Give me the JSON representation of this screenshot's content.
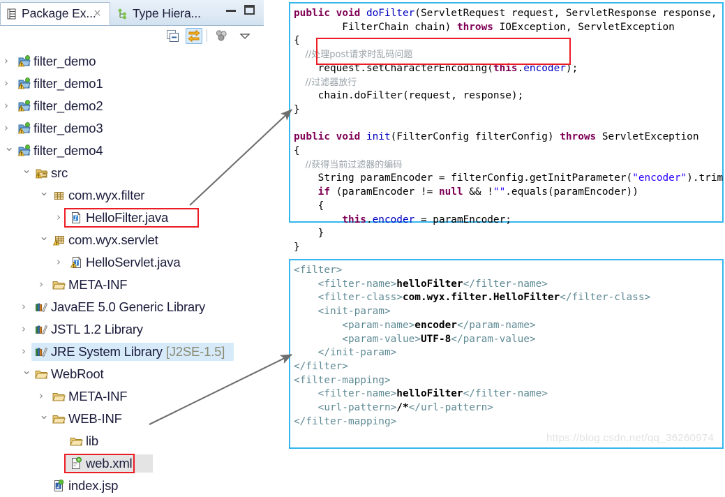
{
  "window": {
    "minimize_label": "Minimize",
    "maximize_label": "Maximize"
  },
  "tabs": [
    {
      "label": "Package Ex...",
      "icon": "package-explorer-icon",
      "active": true,
      "closable": true,
      "close_label": "×"
    },
    {
      "label": "Type Hiera...",
      "icon": "type-hierarchy-icon",
      "active": false,
      "closable": false
    }
  ],
  "toolbar": {
    "collapse_all": "Collapse All",
    "link_with_editor": "Link with Editor",
    "view_menu": "View Menu",
    "chevron": "View Menu Chevron"
  },
  "tree": [
    {
      "label": "filter_demo",
      "indent": 0,
      "twisty": "right",
      "icon": "java-project-icon"
    },
    {
      "label": "filter_demo1",
      "indent": 0,
      "twisty": "right",
      "icon": "java-project-icon"
    },
    {
      "label": "filter_demo2",
      "indent": 0,
      "twisty": "right",
      "icon": "java-project-icon"
    },
    {
      "label": "filter_demo3",
      "indent": 0,
      "twisty": "right",
      "icon": "java-project-icon"
    },
    {
      "label": "filter_demo4",
      "indent": 0,
      "twisty": "down",
      "icon": "java-project-icon"
    },
    {
      "label": "src",
      "indent": 1,
      "twisty": "down",
      "icon": "source-folder-icon"
    },
    {
      "label": "com.wyx.filter",
      "indent": 2,
      "twisty": "down",
      "icon": "package-icon"
    },
    {
      "label": "HelloFilter.java",
      "indent": 3,
      "twisty": "right",
      "icon": "java-file-icon",
      "boxed": true
    },
    {
      "label": "com.wyx.servlet",
      "indent": 2,
      "twisty": "down",
      "icon": "package-warning-icon"
    },
    {
      "label": "HelloServlet.java",
      "indent": 3,
      "twisty": "right",
      "icon": "java-file-warning-icon"
    },
    {
      "label": "META-INF",
      "indent": 2,
      "twisty": "right",
      "icon": "folder-icon"
    },
    {
      "label": "JavaEE 5.0 Generic Library",
      "indent": 1,
      "twisty": "right",
      "icon": "library-icon"
    },
    {
      "label": "JSTL 1.2 Library",
      "indent": 1,
      "twisty": "right",
      "icon": "library-icon"
    },
    {
      "label": "JRE System Library",
      "suffix": " [J2SE-1.5]",
      "indent": 1,
      "twisty": "right",
      "icon": "library-icon",
      "selected": true
    },
    {
      "label": "WebRoot",
      "indent": 1,
      "twisty": "down",
      "icon": "folder-icon"
    },
    {
      "label": "META-INF",
      "indent": 2,
      "twisty": "right",
      "icon": "folder-icon"
    },
    {
      "label": "WEB-INF",
      "indent": 2,
      "twisty": "down",
      "icon": "folder-icon"
    },
    {
      "label": "lib",
      "indent": 3,
      "twisty": "none",
      "icon": "folder-icon"
    },
    {
      "label": "web.xml",
      "indent": 3,
      "twisty": "none",
      "icon": "xml-file-icon",
      "boxed": true,
      "grayed": true
    },
    {
      "label": "index.jsp",
      "indent": 2,
      "twisty": "none",
      "icon": "jsp-file-icon"
    }
  ],
  "java_panel": {
    "name": "HelloFilter.java source",
    "border_color": "#35b6ef",
    "highlight_color": "#ed1c24",
    "lines": [
      [
        [
          "k",
          "public"
        ],
        [
          "p",
          " "
        ],
        [
          "k",
          "void"
        ],
        [
          "p",
          " "
        ],
        [
          "f",
          "doFilter"
        ],
        [
          "p",
          "(ServletRequest request, ServletResponse response,"
        ]
      ],
      [
        [
          "p",
          "        FilterChain chain) "
        ],
        [
          "k",
          "throws"
        ],
        [
          "p",
          " IOException, ServletException"
        ]
      ],
      [
        [
          "p",
          "{"
        ]
      ],
      [
        [
          "c",
          "    //处理post请求时乱码问题"
        ]
      ],
      [
        [
          "p",
          "    request.setCharacterEncoding("
        ],
        [
          "k",
          "this"
        ],
        [
          "p",
          "."
        ],
        [
          "f",
          "encoder"
        ],
        [
          "p",
          ");"
        ]
      ],
      [
        [
          "c",
          "    //过滤器放行"
        ]
      ],
      [
        [
          "p",
          "    chain.doFilter(request, response);"
        ]
      ],
      [
        [
          "p",
          "}"
        ]
      ],
      [
        [
          "p",
          ""
        ]
      ],
      [
        [
          "k",
          "public"
        ],
        [
          "p",
          " "
        ],
        [
          "k",
          "void"
        ],
        [
          "p",
          " "
        ],
        [
          "f",
          "init"
        ],
        [
          "p",
          "(FilterConfig filterConfig) "
        ],
        [
          "k",
          "throws"
        ],
        [
          "p",
          " ServletException"
        ]
      ],
      [
        [
          "p",
          "{"
        ]
      ],
      [
        [
          "c",
          "    //获得当前过滤器的编码"
        ]
      ],
      [
        [
          "p",
          "    String paramEncoder = filterConfig.getInitParameter("
        ],
        [
          "s",
          "\"encoder\""
        ],
        [
          "p",
          ").trim();"
        ]
      ],
      [
        [
          "p",
          "    "
        ],
        [
          "k",
          "if"
        ],
        [
          "p",
          " (paramEncoder != "
        ],
        [
          "k",
          "null"
        ],
        [
          "p",
          " && !"
        ],
        [
          "s",
          "\"\""
        ],
        [
          "p",
          ".equals(paramEncoder))"
        ]
      ],
      [
        [
          "p",
          "    {"
        ]
      ],
      [
        [
          "p",
          "        "
        ],
        [
          "k",
          "this"
        ],
        [
          "p",
          "."
        ],
        [
          "f",
          "encoder"
        ],
        [
          "p",
          " = paramEncoder;"
        ]
      ],
      [
        [
          "p",
          "    }"
        ]
      ],
      [
        [
          "p",
          "}"
        ]
      ]
    ]
  },
  "xml_panel": {
    "name": "web.xml source",
    "border_color": "#35b6ef",
    "lines": [
      [
        [
          "xt",
          "<filter>"
        ]
      ],
      [
        [
          "xt",
          "    <filter-name>"
        ],
        [
          "xv",
          "helloFilter"
        ],
        [
          "xt",
          "</filter-name>"
        ]
      ],
      [
        [
          "xt",
          "    <filter-class>"
        ],
        [
          "xv",
          "com.wyx.filter.HelloFilter"
        ],
        [
          "xt",
          "</filter-class>"
        ]
      ],
      [
        [
          "xt",
          "    <init-param>"
        ]
      ],
      [
        [
          "xt",
          "        <param-name>"
        ],
        [
          "xv",
          "encoder"
        ],
        [
          "xt",
          "</param-name>"
        ]
      ],
      [
        [
          "xt",
          "        <param-value>"
        ],
        [
          "xv",
          "UTF-8"
        ],
        [
          "xt",
          "</param-value>"
        ]
      ],
      [
        [
          "xt",
          "    </init-param>"
        ]
      ],
      [
        [
          "xt",
          "</filter>"
        ]
      ],
      [
        [
          "xt",
          "<filter-mapping>"
        ]
      ],
      [
        [
          "xt",
          "    <filter-name>"
        ],
        [
          "xv",
          "helloFilter"
        ],
        [
          "xt",
          "</filter-name>"
        ]
      ],
      [
        [
          "xt",
          "    <url-pattern>"
        ],
        [
          "xv",
          "/*"
        ],
        [
          "xt",
          "</url-pattern>"
        ]
      ],
      [
        [
          "xt",
          "</filter-mapping>"
        ]
      ]
    ]
  },
  "annotations": {
    "arrow_color": "#6e6e6e",
    "arrow1_name": "arrow-hellofilter-to-code",
    "arrow2_name": "arrow-webxml-to-xml"
  },
  "watermark": "https://blog.csdn.net/qq_36260974"
}
